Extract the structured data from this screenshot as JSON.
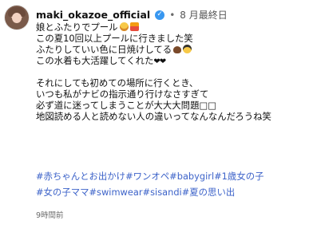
{
  "post": {
    "username": "maki_okazoe_official",
    "posted_label": "8 月最終日",
    "caption_lines": [
      "娘とふたりでプール",
      "この夏10回以上プールに行きました笑",
      "ふたりしていい色に日焼けしてる",
      "この水着も大活躍してくれた",
      "",
      "それにしても初めての場所に行くとき、",
      "いつも私がナビの指示通り行けなさすぎて",
      "必ず道に迷ってしまうことが大大大問題",
      "地図読める人と読めない人の違いってなんなんだろうね笑"
    ],
    "caption_trailing": {
      "line1_emojis": [
        "grinning-face",
        "swimsuit"
      ],
      "line3_emojis": [
        "brown-heart",
        "cool-face"
      ],
      "line4_emojis": "❤❤",
      "line8_marks": "□□"
    },
    "hashtags": [
      "#赤ちゃんとお出かけ",
      "#ワンオペ",
      "#babygirl",
      "#1歳女の子",
      "#女の子ママ",
      "#swimwear",
      "#sisandi",
      "#夏の思い出"
    ],
    "relative_time": "9時間前",
    "colors": {
      "hashtag": "#3d63c9",
      "verified": "#3897f0",
      "muted": "#6b6b6b"
    }
  }
}
